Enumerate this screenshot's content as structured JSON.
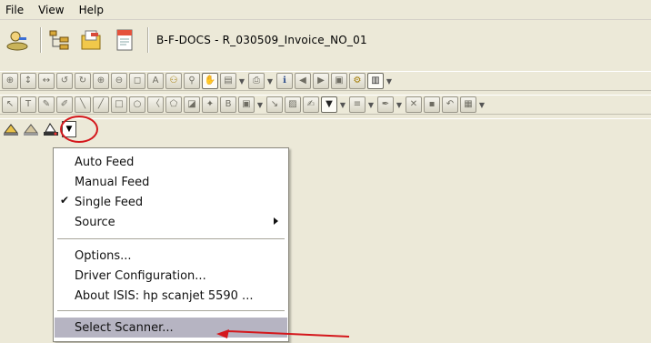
{
  "menubar": {
    "items": [
      "File",
      "View",
      "Help"
    ]
  },
  "document": {
    "title": "B-F-DOCS - R_030509_Invoice_NO_01"
  },
  "menu": {
    "items": [
      {
        "label": "Auto Feed",
        "checked": false,
        "submenu": false
      },
      {
        "label": "Manual Feed",
        "checked": false,
        "submenu": false
      },
      {
        "label": "Single Feed",
        "checked": true,
        "submenu": false
      },
      {
        "label": "Source",
        "checked": false,
        "submenu": true
      },
      {
        "label": "Options...",
        "checked": false,
        "submenu": false
      },
      {
        "label": "Driver Configuration...",
        "checked": false,
        "submenu": false
      },
      {
        "label": "About ISIS: hp scanjet 5590 ...",
        "checked": false,
        "submenu": false
      },
      {
        "label": "Select Scanner...",
        "checked": false,
        "submenu": false,
        "highlighted": true
      }
    ],
    "check_glyph": "✔"
  },
  "colors": {
    "chrome": "#ece9d8",
    "menu_bg": "#ffffff",
    "highlight": "#b6b4c2",
    "annotation_red": "#d4171c"
  }
}
